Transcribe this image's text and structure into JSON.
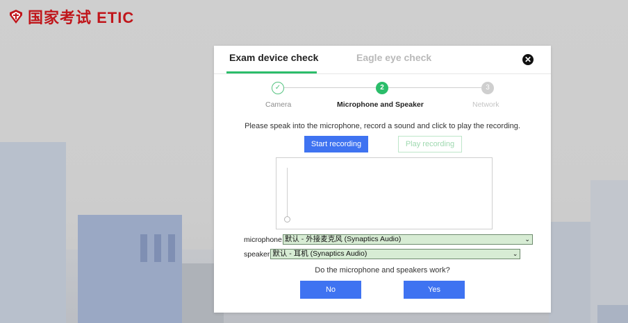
{
  "logo": {
    "text": "国家考试 ETIC"
  },
  "tabs": [
    {
      "label": "Exam device check",
      "active": true
    },
    {
      "label": "Eagle eye check",
      "active": false
    }
  ],
  "stepper": {
    "steps": [
      {
        "number": "",
        "label": "Camera",
        "state": "done"
      },
      {
        "number": "2",
        "label": "Microphone and Speaker",
        "state": "active"
      },
      {
        "number": "3",
        "label": "Network",
        "state": "pending"
      }
    ]
  },
  "instruction": "Please speak into the microphone, record a sound and click to play the recording.",
  "buttons": {
    "start": "Start recording",
    "play": "Play recording",
    "no": "No",
    "yes": "Yes"
  },
  "devices": {
    "microphone_label": "microphone",
    "microphone_value": "默认 - 外接麦克风 (Synaptics Audio)",
    "speaker_label": "speaker",
    "speaker_value": "默认 - 耳机 (Synaptics Audio)"
  },
  "question": "Do the microphone and speakers work?",
  "colors": {
    "accent_green": "#2bbd6a",
    "button_blue": "#3f73f1",
    "logo_red": "#c0161b"
  },
  "icons": {
    "close": "close-icon",
    "step_done": "check-icon"
  }
}
